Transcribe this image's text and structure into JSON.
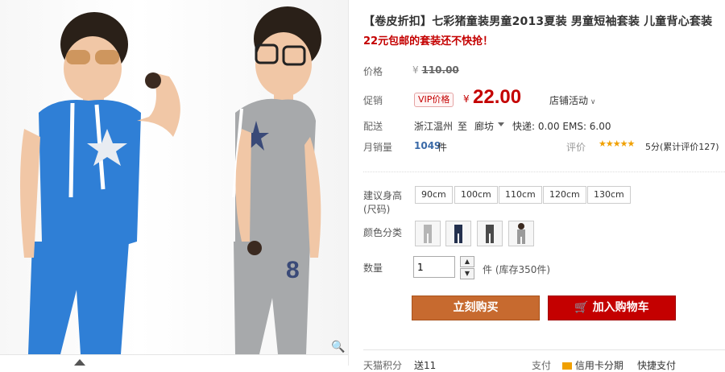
{
  "title": "【卷皮折扣】七彩猪童装男童2013夏装 男童短袖套装 儿童背心套装",
  "subtitle": "22元包邮的套装还不快抢！",
  "price": {
    "label": "价格",
    "currency": "¥",
    "original": "110.00"
  },
  "promo_price": {
    "label": "促销",
    "vip_badge": "VIP价格",
    "currency": "¥",
    "value": "22.00",
    "activity": "店铺活动"
  },
  "shipping": {
    "label": "配送",
    "from": "浙江温州",
    "to_word": "至",
    "to": "廊坊",
    "fee": "快递: 0.00 EMS: 6.00"
  },
  "sales": {
    "label": "月销量",
    "count": "1049",
    "unit": "件",
    "rating_label": "评价",
    "stars": "★★★★★",
    "rating_text": "5分(累计评价127)"
  },
  "size": {
    "label": "建议身高(尺码)",
    "options": [
      "90cm",
      "100cm",
      "110cm",
      "120cm",
      "130cm"
    ]
  },
  "color": {
    "label": "颜色分类"
  },
  "quantity": {
    "label": "数量",
    "value": "1",
    "stock_text": "件 (库存350件)"
  },
  "buttons": {
    "buy": "立刻购买",
    "cart": "加入购物车"
  },
  "bottom": {
    "left_a": "天猫积分",
    "left_b": "送11",
    "mid": "支付",
    "credit": "信用卡分期",
    "right": "快捷支付"
  },
  "colors": {
    "price_red": "#c40000",
    "buy_orange": "#c76a2f",
    "shirt_blue": "#2f7fd6",
    "shirt_gray": "#a7a9ab"
  }
}
